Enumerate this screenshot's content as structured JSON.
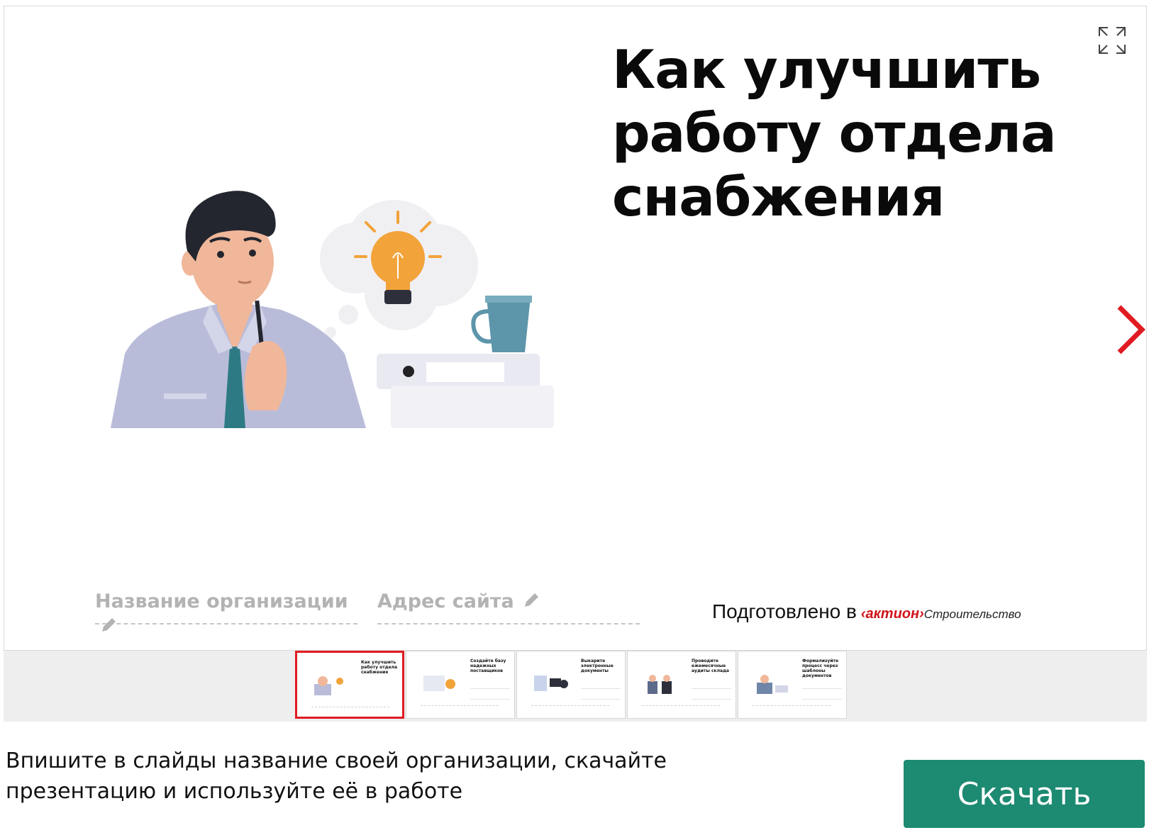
{
  "slide": {
    "title_lines": [
      "Как улучшить",
      "работу отдела",
      "снабжения"
    ],
    "fields": {
      "organization_placeholder": "Название организации",
      "site_placeholder": "Адрес сайта"
    },
    "prepared": {
      "text": "Подготовлено в",
      "brand": "‹актион›",
      "brand_sub": "Строительство"
    }
  },
  "thumbnails": [
    {
      "title": "Как улучшить работу отдела снабжения",
      "active": true
    },
    {
      "title": "Создайте базу надежных поставщиков",
      "active": false
    },
    {
      "title": "Выкарите электронные документы",
      "active": false
    },
    {
      "title": "Проводите ежемесячные аудиты склада",
      "active": false
    },
    {
      "title": "Формализуйте процесс через шаблоны документов",
      "active": false
    }
  ],
  "footer": {
    "instructions_line1": "Впишите в слайды название своей организации, скачайте",
    "instructions_line2": "презентацию и используйте её в работе",
    "download_label": "Скачать"
  },
  "icons": {
    "fullscreen": "expand-arrows-icon",
    "next": "chevron-right-icon",
    "edit": "pencil-icon"
  },
  "colors": {
    "accent_red": "#e01b22",
    "button_green": "#1d8a72",
    "placeholder_gray": "#b3b3b3"
  }
}
